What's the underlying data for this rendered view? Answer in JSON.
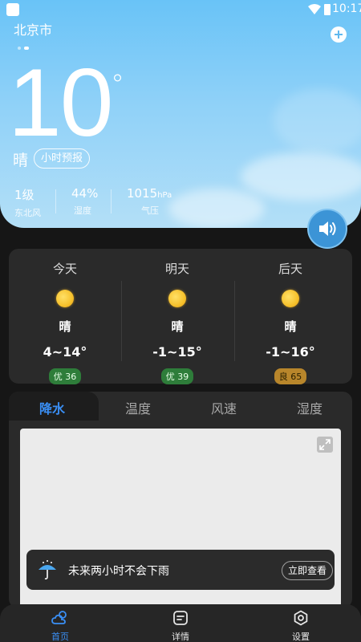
{
  "status_bar": {
    "time": "10:17"
  },
  "location": {
    "city": "北京市"
  },
  "current": {
    "temperature": "10",
    "degree_symbol": "°",
    "condition": "晴",
    "hourly_button": "小时预报"
  },
  "stats": [
    {
      "value": "1级",
      "unit": "",
      "label": "东北风"
    },
    {
      "value": "44%",
      "unit": "",
      "label": "湿度"
    },
    {
      "value": "1015",
      "unit": "hPa",
      "label": "气压"
    }
  ],
  "forecast": [
    {
      "day": "今天",
      "icon": "sun-icon",
      "condition": "晴",
      "range": "4~14°",
      "aqi": "优 36",
      "aqi_level": "good"
    },
    {
      "day": "明天",
      "icon": "sun-icon",
      "condition": "晴",
      "range": "-1~15°",
      "aqi": "优 39",
      "aqi_level": "good"
    },
    {
      "day": "后天",
      "icon": "sun-icon",
      "condition": "晴",
      "range": "-1~16°",
      "aqi": "良 65",
      "aqi_level": "ok"
    }
  ],
  "chart_tabs": [
    {
      "label": "降水",
      "active": true
    },
    {
      "label": "温度",
      "active": false
    },
    {
      "label": "风速",
      "active": false
    },
    {
      "label": "湿度",
      "active": false
    }
  ],
  "precip": {
    "message": "未来两小时不会下雨",
    "view_button": "立即查看"
  },
  "bottom_nav": [
    {
      "label": "首页",
      "icon": "weather-cloud-icon",
      "active": true
    },
    {
      "label": "详情",
      "icon": "details-icon",
      "active": false
    },
    {
      "label": "设置",
      "icon": "settings-icon",
      "active": false
    }
  ],
  "colors": {
    "accent": "#3a8ff5",
    "hero_top": "#69c3f7",
    "aqi_good": "#2e7d3a",
    "aqi_ok": "#b8862b"
  }
}
